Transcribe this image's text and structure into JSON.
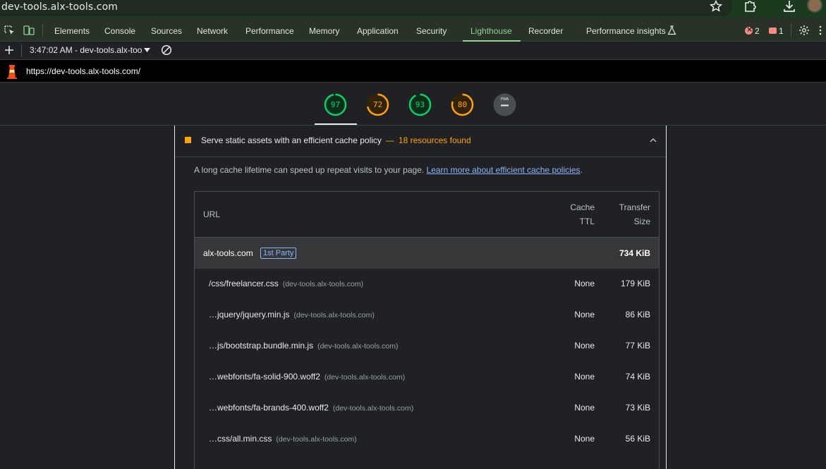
{
  "browser": {
    "url": "dev-tools.alx-tools.com",
    "icons": [
      "star-icon",
      "extensions-icon",
      "download-icon",
      "avatar"
    ]
  },
  "devtools": {
    "tabs": [
      "Elements",
      "Console",
      "Sources",
      "Network",
      "Performance",
      "Memory",
      "Application",
      "Security",
      "Lighthouse",
      "Recorder",
      "Performance insights"
    ],
    "active_tab": "Lighthouse",
    "error_count": "2",
    "issue_count": "1"
  },
  "lighthouse": {
    "report_select": "3:47:02 AM - dev-tools.alx-too",
    "url": "https://dev-tools.alx-tools.com/",
    "scores": [
      {
        "value": "97",
        "fraction": 0.97,
        "color": "#0cce6b"
      },
      {
        "value": "72",
        "fraction": 0.72,
        "color": "#ffa400"
      },
      {
        "value": "93",
        "fraction": 0.93,
        "color": "#0cce6b"
      },
      {
        "value": "80",
        "fraction": 0.8,
        "color": "#ffa400"
      }
    ],
    "pwa_label": "PWA"
  },
  "audit": {
    "title": "Serve static assets with an efficient cache policy",
    "dash": "—",
    "display_value": "18 resources found",
    "description": "A long cache lifetime can speed up repeat visits to your page.",
    "learn_more": "Learn more about efficient cache policies",
    "description_end": ".",
    "headers": {
      "url": "URL",
      "ttl_line1": "Cache",
      "ttl_line2": "TTL",
      "size_line1": "Transfer",
      "size_line2": "Size"
    },
    "group": {
      "name": "alx-tools.com",
      "badge": "1st Party",
      "size": "734 KiB"
    },
    "rows": [
      {
        "url": "/css/freelancer.css",
        "host": "(dev-tools.alx-tools.com)",
        "ttl": "None",
        "size": "179 KiB"
      },
      {
        "url": "…jquery/jquery.min.js",
        "host": "(dev-tools.alx-tools.com)",
        "ttl": "None",
        "size": "86 KiB"
      },
      {
        "url": "…js/bootstrap.bundle.min.js",
        "host": "(dev-tools.alx-tools.com)",
        "ttl": "None",
        "size": "77 KiB"
      },
      {
        "url": "…webfonts/fa-solid-900.woff2",
        "host": "(dev-tools.alx-tools.com)",
        "ttl": "None",
        "size": "74 KiB"
      },
      {
        "url": "…webfonts/fa-brands-400.woff2",
        "host": "(dev-tools.alx-tools.com)",
        "ttl": "None",
        "size": "73 KiB"
      },
      {
        "url": "…css/all.min.css",
        "host": "(dev-tools.alx-tools.com)",
        "ttl": "None",
        "size": "56 KiB"
      }
    ]
  }
}
